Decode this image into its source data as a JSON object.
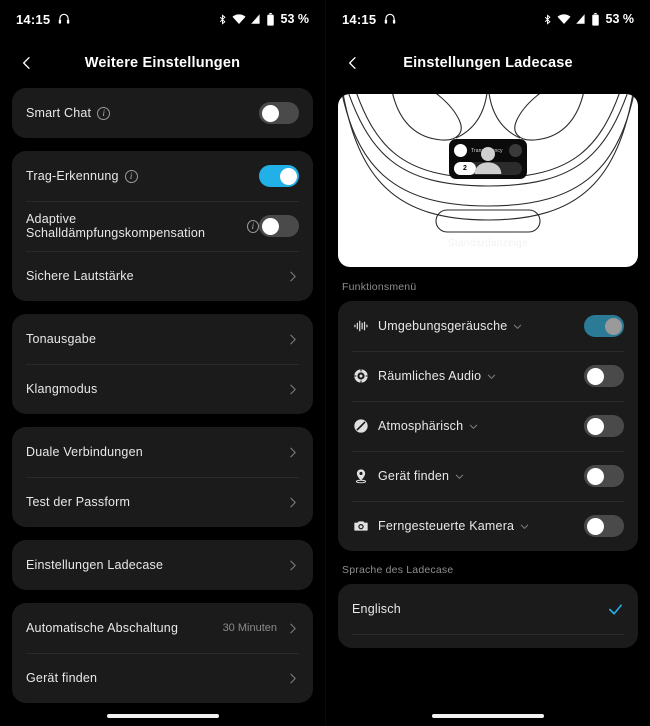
{
  "status_bar": {
    "time": "14:15",
    "battery_percent": "53 %",
    "icons": [
      "headphones-icon",
      "bluetooth-icon",
      "wifi-icon",
      "cellular-signal-icon",
      "battery-icon"
    ]
  },
  "left_screen": {
    "header": {
      "title": "Weitere Einstellungen",
      "back_icon": "chevron-left-icon"
    },
    "groups": [
      {
        "rows": [
          {
            "label": "Smart Chat",
            "info": true,
            "type": "toggle",
            "state": "off"
          }
        ]
      },
      {
        "rows": [
          {
            "label": "Trag-Erkennung",
            "info": true,
            "type": "toggle",
            "state": "on"
          },
          {
            "label": "Adaptive Schalldämpfungskompensation",
            "info": true,
            "type": "toggle",
            "state": "off"
          },
          {
            "label": "Sichere Lautstärke",
            "info": false,
            "type": "chevron"
          }
        ]
      },
      {
        "rows": [
          {
            "label": "Tonausgabe",
            "info": false,
            "type": "chevron"
          },
          {
            "label": "Klangmodus",
            "info": false,
            "type": "chevron"
          }
        ]
      },
      {
        "rows": [
          {
            "label": "Duale Verbindungen",
            "info": false,
            "type": "chevron"
          },
          {
            "label": "Test der Passform",
            "info": false,
            "type": "chevron"
          }
        ]
      },
      {
        "rows": [
          {
            "label": "Einstellungen Ladecase",
            "info": false,
            "type": "chevron"
          }
        ]
      },
      {
        "rows": [
          {
            "label": "Automatische Abschaltung",
            "info": false,
            "type": "chevron",
            "value": "30 Minuten"
          },
          {
            "label": "Gerät finden",
            "info": false,
            "type": "chevron"
          }
        ]
      }
    ]
  },
  "right_screen": {
    "header": {
      "title": "Einstellungen Ladecase",
      "back_icon": "chevron-left-icon"
    },
    "illustration": {
      "name": "charging-case-illustration",
      "caption": "Standardanzeige",
      "case_display": {
        "mode_label": "Transparency",
        "counter": "2",
        "left_icon": "transparency-mode-icon",
        "right_icon": "noise-cancel-mode-icon"
      }
    },
    "function_menu": {
      "section_label": "Funktionsmenü",
      "items": [
        {
          "label": "Umgebungsgeräusche",
          "icon": "waveform-icon",
          "state": "on",
          "disabled": true
        },
        {
          "label": "Räumliches Audio",
          "icon": "spatial-audio-icon",
          "state": "off",
          "disabled": false
        },
        {
          "label": "Atmosphärisch",
          "icon": "atmosphere-icon",
          "state": "off",
          "disabled": false
        },
        {
          "label": "Gerät finden",
          "icon": "location-pin-icon",
          "state": "off",
          "disabled": false
        },
        {
          "label": "Ferngesteuerte Kamera",
          "icon": "camera-icon",
          "state": "off",
          "disabled": false
        }
      ]
    },
    "language": {
      "section_label": "Sprache des Ladecase",
      "options": [
        {
          "label": "Englisch",
          "selected": true
        }
      ]
    }
  },
  "theme": {
    "accent": "#22b0e8",
    "accent_disabled": "#2b7a96",
    "background": "#000000",
    "card": "#1b1b1b",
    "text_primary": "#e8e8e8",
    "text_secondary": "#8e8e8e"
  }
}
